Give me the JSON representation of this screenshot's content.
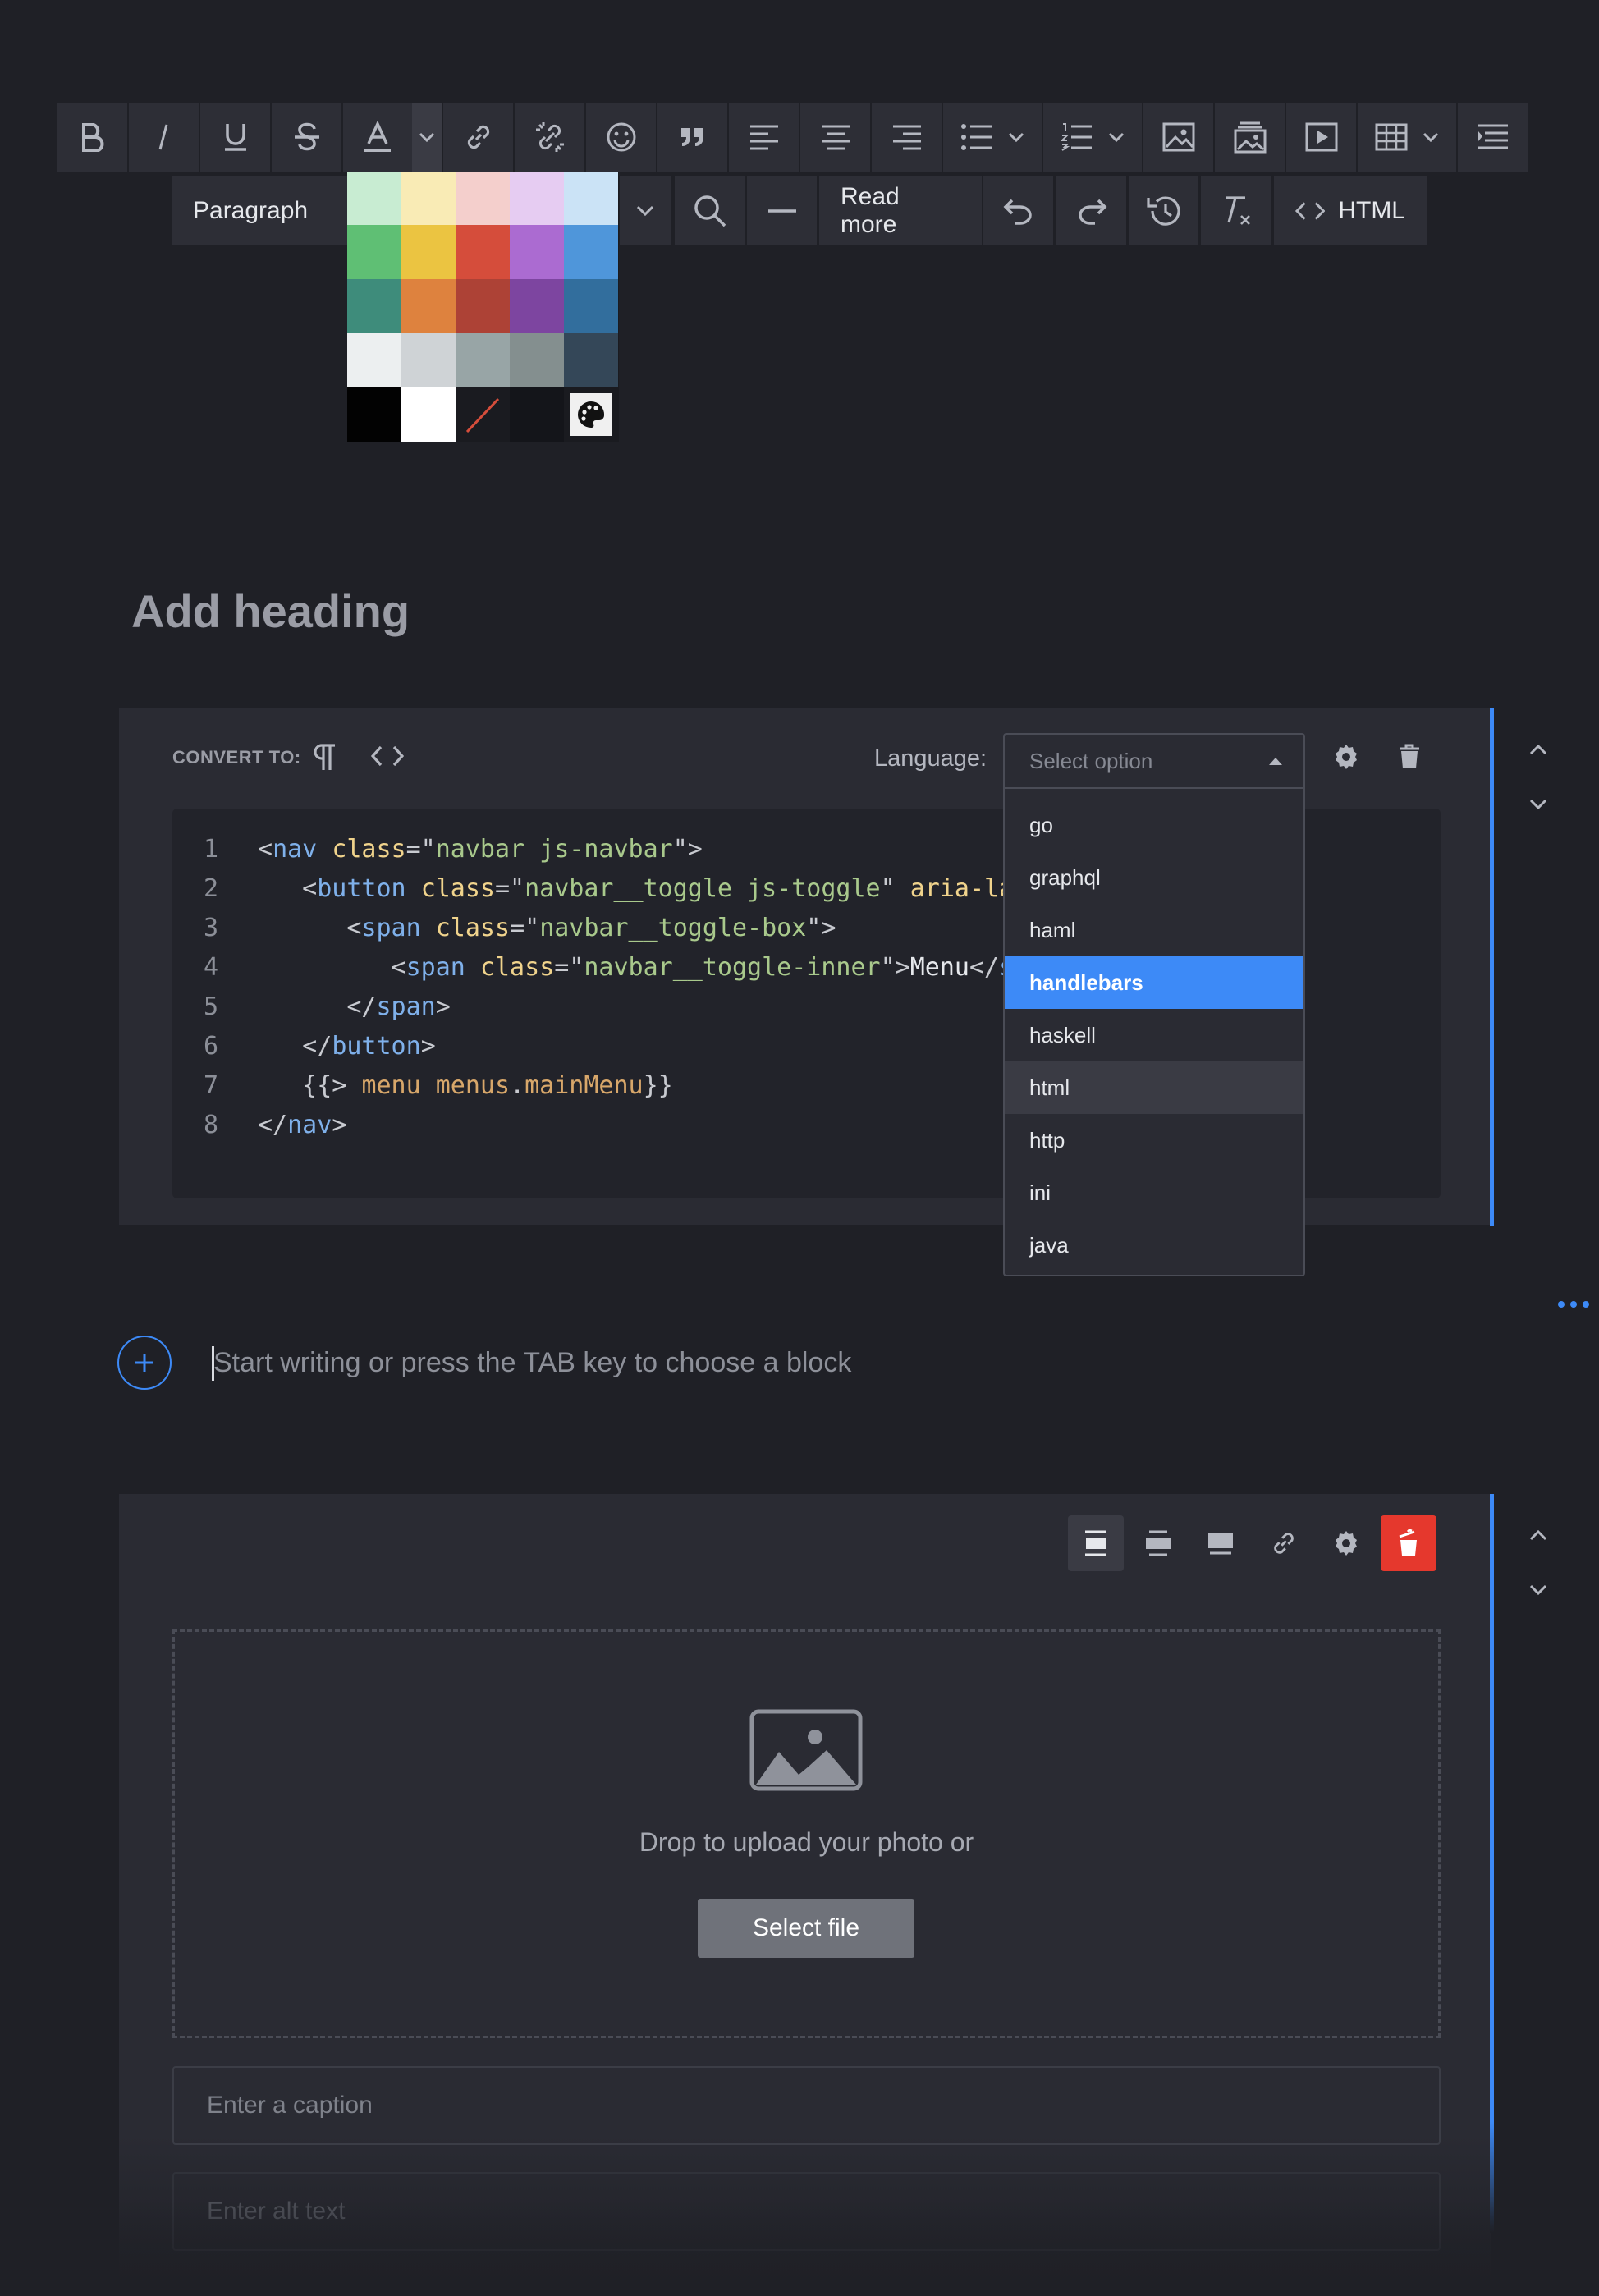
{
  "toolbar": {
    "row1": [
      "bold-icon",
      "italic-icon",
      "underline-icon",
      "strikethrough-icon",
      "font-color-icon",
      "link-icon",
      "unlink-icon",
      "emoji-icon",
      "blockquote-icon",
      "align-left-icon",
      "align-center-icon",
      "align-right-icon",
      "bulleted-list-icon",
      "numbered-list-icon",
      "image-icon",
      "gallery-icon",
      "video-icon",
      "table-icon",
      "outline-icon"
    ],
    "paragraph_label": "Paragraph",
    "read_more_label": "Read more",
    "html_label": "HTML"
  },
  "palette": {
    "colors": [
      "#c8ecd2",
      "#f9ebb5",
      "#f4cfcc",
      "#e6ccf2",
      "#cbe3f6",
      "#5fbf74",
      "#ebc441",
      "#d54d3b",
      "#ab6bd1",
      "#4f96da",
      "#3e8c7b",
      "#de823e",
      "#ad4236",
      "#7d45a0",
      "#326e9d",
      "#eceff0",
      "#cfd3d6",
      "#98a5a6",
      "#848f8f",
      "#344758",
      "#020202",
      "#ffffff",
      "none",
      "#14151a",
      "custom"
    ]
  },
  "heading": {
    "placeholder": "Add heading"
  },
  "code_block": {
    "convert_to_label": "CONVERT TO:",
    "language_label": "Language:",
    "select_placeholder": "Select option",
    "lines": [
      {
        "n": "1",
        "tokens": [
          [
            "punc",
            "<"
          ],
          [
            "tag",
            "nav"
          ],
          [
            "punc",
            " "
          ],
          [
            "attr",
            "class"
          ],
          [
            "punc",
            "=\""
          ],
          [
            "str",
            "navbar js-navbar"
          ],
          [
            "punc",
            "\">"
          ]
        ]
      },
      {
        "n": "2",
        "tokens": [
          [
            "punc",
            "   <"
          ],
          [
            "tag",
            "button"
          ],
          [
            "punc",
            " "
          ],
          [
            "attr",
            "class"
          ],
          [
            "punc",
            "=\""
          ],
          [
            "str",
            "navbar__toggle js-toggle"
          ],
          [
            "punc",
            "\" "
          ],
          [
            "attr",
            "aria-lab"
          ]
        ]
      },
      {
        "n": "3",
        "tokens": [
          [
            "punc",
            "      <"
          ],
          [
            "tag",
            "span"
          ],
          [
            "punc",
            " "
          ],
          [
            "attr",
            "class"
          ],
          [
            "punc",
            "=\""
          ],
          [
            "str",
            "navbar__toggle-box"
          ],
          [
            "punc",
            "\">"
          ]
        ]
      },
      {
        "n": "4",
        "tokens": [
          [
            "punc",
            "         <"
          ],
          [
            "tag",
            "span"
          ],
          [
            "punc",
            " "
          ],
          [
            "attr",
            "class"
          ],
          [
            "punc",
            "=\""
          ],
          [
            "str",
            "navbar__toggle-inner"
          ],
          [
            "punc",
            "\">"
          ],
          [
            "txt",
            "Menu"
          ],
          [
            "punc",
            "</"
          ],
          [
            "tag",
            "sp"
          ]
        ]
      },
      {
        "n": "5",
        "tokens": [
          [
            "punc",
            "      </"
          ],
          [
            "tag",
            "span"
          ],
          [
            "punc",
            ">"
          ]
        ]
      },
      {
        "n": "6",
        "tokens": [
          [
            "punc",
            "   </"
          ],
          [
            "tag",
            "button"
          ],
          [
            "punc",
            ">"
          ]
        ]
      },
      {
        "n": "7",
        "tokens": [
          [
            "punc",
            "   {{> "
          ],
          [
            "hb",
            "menu"
          ],
          [
            "punc",
            " "
          ],
          [
            "hb",
            "menus"
          ],
          [
            "punc",
            "."
          ],
          [
            "hb",
            "mainMenu"
          ],
          [
            "punc",
            "}}"
          ]
        ]
      },
      {
        "n": "8",
        "tokens": [
          [
            "punc",
            "</"
          ],
          [
            "tag",
            "nav"
          ],
          [
            "punc",
            ">"
          ]
        ]
      }
    ]
  },
  "language_dropdown": {
    "options": [
      "go",
      "graphql",
      "haml",
      "handlebars",
      "haskell",
      "html",
      "http",
      "ini",
      "java"
    ],
    "active": "handlebars",
    "hovered": "html"
  },
  "paragraph_block": {
    "placeholder": "Start writing or press the TAB key to choose a block"
  },
  "image_block": {
    "drop_text": "Drop to upload your photo or",
    "select_file_label": "Select file",
    "caption_placeholder": "Enter a caption",
    "alt_placeholder": "Enter alt text"
  },
  "colors": {
    "accent": "#3d8af7",
    "danger": "#e5382d"
  }
}
